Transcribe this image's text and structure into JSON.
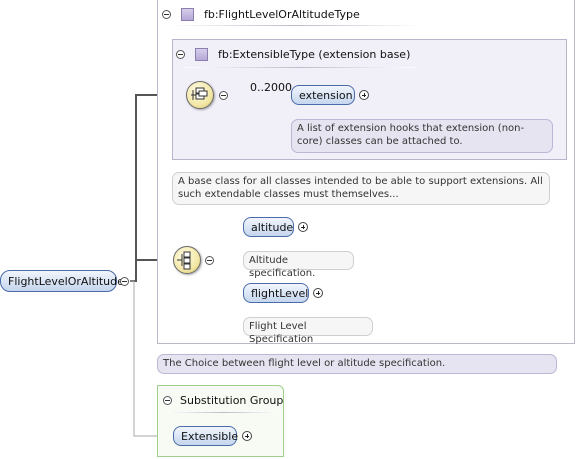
{
  "root_element": {
    "label": "FlightLevelOrAltitude"
  },
  "complex_type": {
    "label": "fb:FlightLevelOrAltitudeType"
  },
  "extension_base": {
    "label": "fb:ExtensibleType (extension base)"
  },
  "extension_element": {
    "label": "extension",
    "occurrence": "0..2000",
    "doc": "A list of extension hooks that extension (non-core) classes can be attached to."
  },
  "type_doc": "A base class for all classes intended to be able to support extensions. All such extendable classes must themselves...",
  "choice": {
    "items": [
      {
        "label": "altitude",
        "doc": "Altitude specification."
      },
      {
        "label": "flightLevel",
        "doc": "Flight Level Specification"
      }
    ],
    "doc": "The Choice between flight level or altitude specification."
  },
  "substitution_group": {
    "label": "Substitution Group",
    "member": "Extensible"
  },
  "colors": {
    "element_border": "#4a6ca8",
    "element_fill": "#c5d6ee",
    "type_box_fill": "#f1eff7",
    "compositor_fill": "#f3e8a8"
  },
  "icons": [
    "collapse-icon",
    "expand-icon",
    "sequence-icon",
    "choice-icon",
    "complex-type-icon"
  ]
}
